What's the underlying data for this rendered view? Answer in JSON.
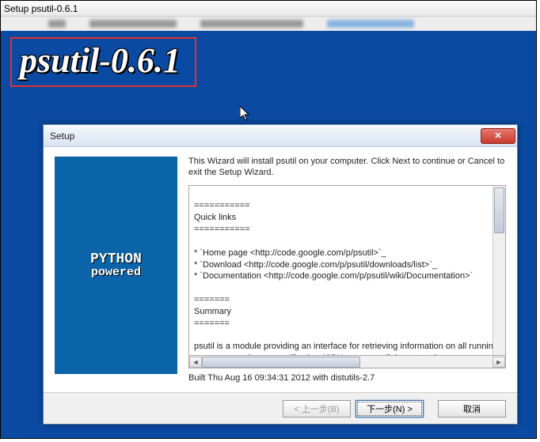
{
  "outer": {
    "title": "Setup psutil-0.6.1"
  },
  "banner": {
    "title": "psutil-0.6.1"
  },
  "installer": {
    "title": "Setup",
    "close": "✕",
    "side_logo_line1": "PYTHON",
    "side_logo_line2": "powered",
    "intro": "This Wizard will install psutil on your computer. Click Next to continue or Cancel to exit the Setup Wizard.",
    "textbox": "===========\nQuick links\n===========\n\n* `Home page <http://code.google.com/p/psutil>`_\n* `Download <http://code.google.com/p/psutil/downloads/list>`_\n* `Documentation <http://code.google.com/p/psutil/wiki/Documentation>`\n\n=======\nSummary\n=======\n\npsutil is a module providing an interface for retrieving information on all running processes and system utilization (CPU, memory, disks, network, us",
    "built": "Built Thu Aug 16 09:34:31 2012 with distutils-2.7",
    "buttons": {
      "back": "< 上一步(B)",
      "next": "下一步(N) >",
      "cancel": "取消"
    }
  }
}
